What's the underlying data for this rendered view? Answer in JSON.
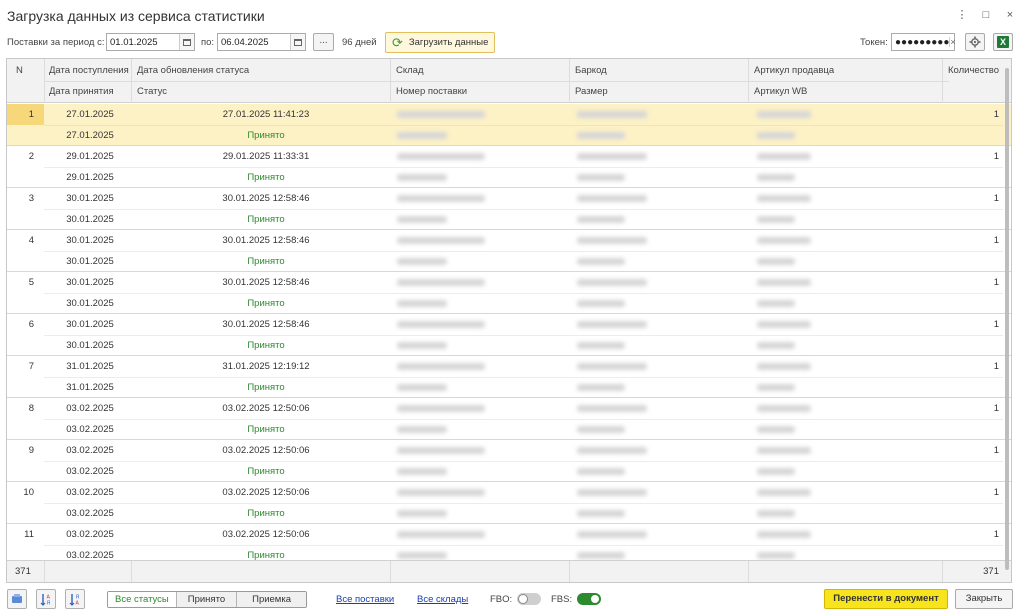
{
  "window": {
    "title": "Загрузка данных из сервиса статистики",
    "more_icon": "⋮",
    "maximize_icon": "□",
    "close_icon": "×"
  },
  "toolbar": {
    "period_label": "Поставки за период с:",
    "date_from": "01.01.2025",
    "to_label": "по:",
    "date_to": "06.04.2025",
    "dots_label": "...",
    "days_label": "96 дней",
    "load_label": "Загрузить данные",
    "token_label": "Токен:",
    "token_value": "●●●●●●●●●",
    "token_clear": "×"
  },
  "columns": {
    "n": "N",
    "date_received": "Дата поступления",
    "date_status": "Дата обновления статуса",
    "warehouse": "Склад",
    "barcode": "Баркод",
    "seller_article": "Артикул продавца",
    "quantity": "Количество",
    "date_accepted": "Дата принятия",
    "status": "Статус",
    "supply_number": "Номер поставки",
    "size": "Размер",
    "wb_article": "Артикул WB"
  },
  "rows": [
    {
      "n": "1",
      "date_received": "27.01.2025",
      "status_updated": "27.01.2025 11:41:23",
      "date_accepted": "27.01.2025",
      "status": "Принято",
      "quantity": "1",
      "selected": true
    },
    {
      "n": "2",
      "date_received": "29.01.2025",
      "status_updated": "29.01.2025 11:33:31",
      "date_accepted": "29.01.2025",
      "status": "Принято",
      "quantity": "1"
    },
    {
      "n": "3",
      "date_received": "30.01.2025",
      "status_updated": "30.01.2025 12:58:46",
      "date_accepted": "30.01.2025",
      "status": "Принято",
      "quantity": "1"
    },
    {
      "n": "4",
      "date_received": "30.01.2025",
      "status_updated": "30.01.2025 12:58:46",
      "date_accepted": "30.01.2025",
      "status": "Принято",
      "quantity": "1"
    },
    {
      "n": "5",
      "date_received": "30.01.2025",
      "status_updated": "30.01.2025 12:58:46",
      "date_accepted": "30.01.2025",
      "status": "Принято",
      "quantity": "1"
    },
    {
      "n": "6",
      "date_received": "30.01.2025",
      "status_updated": "30.01.2025 12:58:46",
      "date_accepted": "30.01.2025",
      "status": "Принято",
      "quantity": "1"
    },
    {
      "n": "7",
      "date_received": "31.01.2025",
      "status_updated": "31.01.2025 12:19:12",
      "date_accepted": "31.01.2025",
      "status": "Принято",
      "quantity": "1"
    },
    {
      "n": "8",
      "date_received": "03.02.2025",
      "status_updated": "03.02.2025 12:50:06",
      "date_accepted": "03.02.2025",
      "status": "Принято",
      "quantity": "1"
    },
    {
      "n": "9",
      "date_received": "03.02.2025",
      "status_updated": "03.02.2025 12:50:06",
      "date_accepted": "03.02.2025",
      "status": "Принято",
      "quantity": "1"
    },
    {
      "n": "10",
      "date_received": "03.02.2025",
      "status_updated": "03.02.2025 12:50:06",
      "date_accepted": "03.02.2025",
      "status": "Принято",
      "quantity": "1"
    },
    {
      "n": "11",
      "date_received": "03.02.2025",
      "status_updated": "03.02.2025 12:50:06",
      "date_accepted": "03.02.2025",
      "status": "Принято",
      "quantity": "1"
    }
  ],
  "footer": {
    "count_left": "371",
    "count_right": "371"
  },
  "bottom": {
    "filter_all": "Все статусы",
    "filter_accepted": "Принято",
    "filter_receiving": "Приемка",
    "link_all_supplies": "Все поставки",
    "link_all_warehouses": "Все склады",
    "fbo_label": "FBO:",
    "fbo_on": false,
    "fbs_label": "FBS:",
    "fbs_on": true,
    "transfer_label": "Перенести в документ",
    "close_label": "Закрыть"
  },
  "colors": {
    "selected_row": "#fdf1c6",
    "status_ok": "#2e8a2e",
    "primary_button": "#f8e41c",
    "link": "#1a3fb0"
  }
}
